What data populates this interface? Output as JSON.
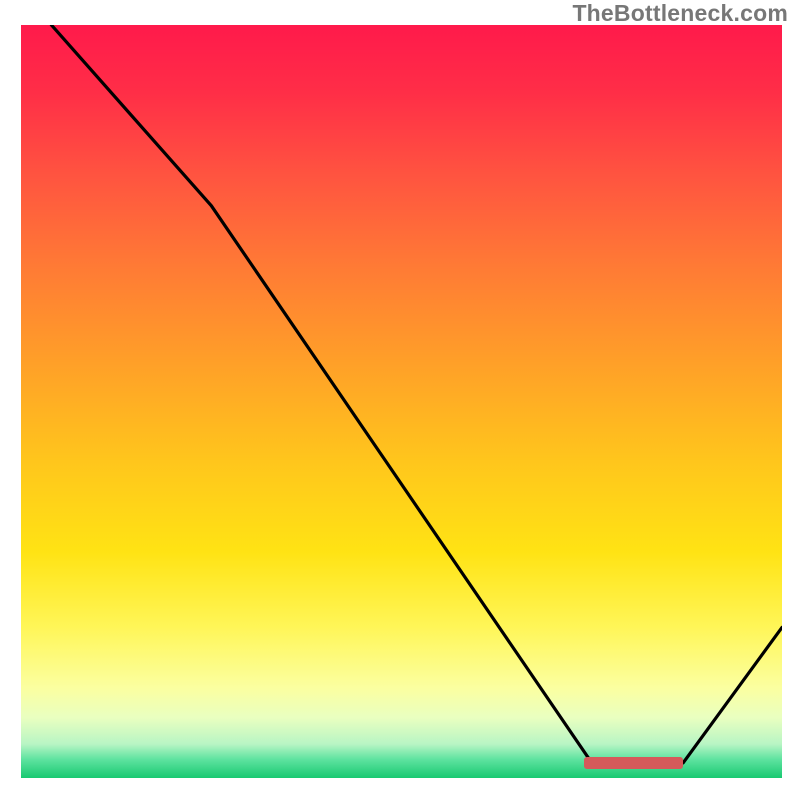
{
  "watermark": "TheBottleneck.com",
  "chart_data": {
    "type": "line",
    "title": "",
    "xlabel": "",
    "ylabel": "",
    "xlim": [
      0,
      100
    ],
    "ylim": [
      0,
      100
    ],
    "background": "heatmap-gradient",
    "series": [
      {
        "name": "curve",
        "x": [
          4,
          25,
          75,
          87,
          100
        ],
        "y": [
          100,
          76,
          2,
          2,
          20
        ],
        "color": "#000000"
      }
    ],
    "annotations": [
      {
        "name": "minimum-band",
        "x_range": [
          74,
          87
        ],
        "y": 2,
        "color": "#d55a5a"
      }
    ],
    "gradient_stops": [
      {
        "offset": 0.0,
        "color": "#ff1a4b"
      },
      {
        "offset": 0.09,
        "color": "#ff2e47"
      },
      {
        "offset": 0.2,
        "color": "#ff5440"
      },
      {
        "offset": 0.32,
        "color": "#ff7a35"
      },
      {
        "offset": 0.45,
        "color": "#ffa028"
      },
      {
        "offset": 0.58,
        "color": "#ffc61c"
      },
      {
        "offset": 0.7,
        "color": "#ffe314"
      },
      {
        "offset": 0.8,
        "color": "#fff658"
      },
      {
        "offset": 0.88,
        "color": "#fbffa0"
      },
      {
        "offset": 0.92,
        "color": "#e9ffc0"
      },
      {
        "offset": 0.955,
        "color": "#b8f5c4"
      },
      {
        "offset": 0.975,
        "color": "#5fe3a0"
      },
      {
        "offset": 1.0,
        "color": "#18c971"
      }
    ]
  }
}
